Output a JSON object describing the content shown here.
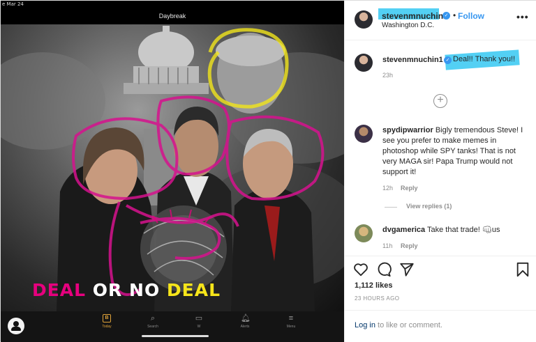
{
  "status": {
    "date": "e Mar 24"
  },
  "app": {
    "title": "Daybreak"
  },
  "poster": {
    "word1": "DEAL",
    "word2": "OR",
    "word3": "NO",
    "word4": "DEAL"
  },
  "tabbar": {
    "tabs": [
      {
        "label": "Today",
        "icon": "B",
        "active": true
      },
      {
        "label": "Search",
        "icon": "⌕"
      },
      {
        "label": "W",
        "icon": "▭"
      },
      {
        "label": "Alerts",
        "icon": "🔔︎"
      },
      {
        "label": "Menu",
        "icon": "≡"
      }
    ]
  },
  "post": {
    "username": "stevenmnuchin1",
    "follow_label": "Follow",
    "separator": "•",
    "location": "Washington D.C.",
    "more_label": "•••",
    "caption": {
      "user": "stevenmnuchin1",
      "text": "Deal!! Thank you!!",
      "time": "23h"
    },
    "load_more": "+",
    "comments": [
      {
        "user": "spydipwarrior",
        "text": "Bigly tremendous Steve! I see you prefer to make memes in photoshop while SPY tanks! That is not very MAGA sir! Papa Trump would not support it!",
        "time": "12h",
        "reply": "Reply",
        "view_replies": "View replies (1)"
      },
      {
        "user": "dvgamerica",
        "text": "Take that trade! 👊︎us",
        "time": "11h",
        "reply": "Reply"
      }
    ],
    "likes": "1,112 likes",
    "time_ago": "23 HOURS AGO",
    "login_link": "Log in",
    "login_text": " to like or comment."
  },
  "colors": {
    "accent": "#3897f0",
    "highlight": "#35c8f2",
    "magenta": "#e6007e",
    "yellow": "#f6e51a"
  }
}
